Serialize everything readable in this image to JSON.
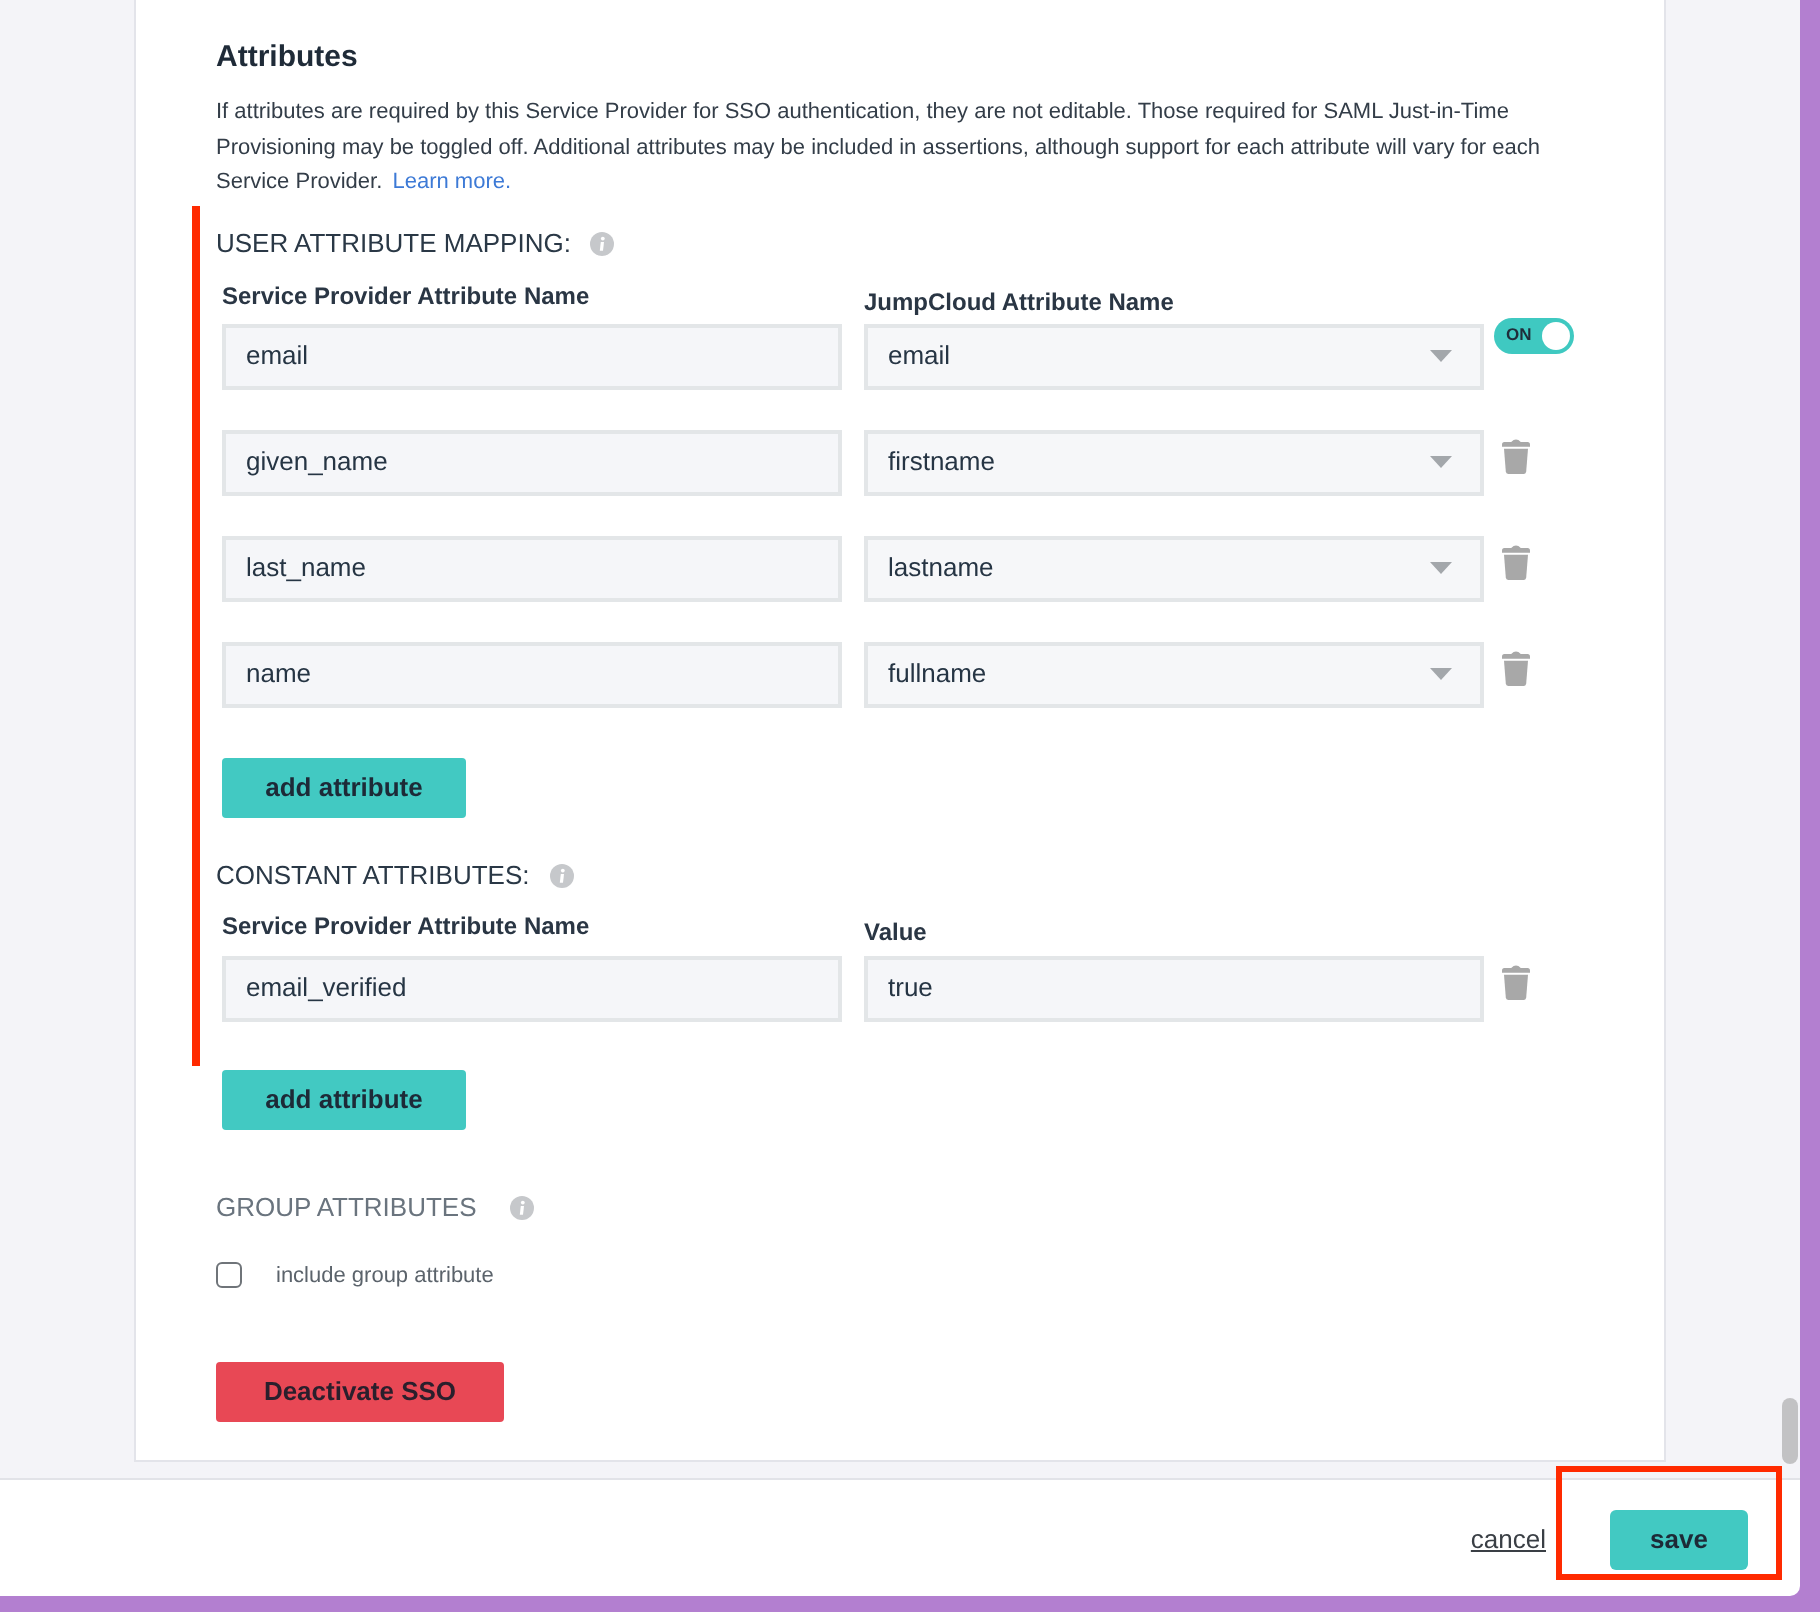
{
  "section": {
    "title": "Attributes",
    "description": "If attributes are required by this Service Provider for SSO authentication, they are not editable. Those required for SAML Just-in-Time Provisioning may be toggled off. Additional attributes may be included in assertions, although support for each attribute will vary for each Service Provider.",
    "link": "Learn more."
  },
  "user_attribute_mapping": {
    "heading": "USER ATTRIBUTE MAPPING:",
    "columns": [
      "Service Provider Attribute Name",
      "JumpCloud Attribute Name"
    ],
    "rows": [
      {
        "kind": "dropdown",
        "name": "email",
        "value": "email",
        "action": {
          "kind": "toggle",
          "on": true,
          "label": "ON"
        }
      },
      {
        "kind": "dropdown",
        "name": "given_name",
        "value": "firstname",
        "action": {
          "kind": "delete"
        }
      },
      {
        "kind": "dropdown",
        "name": "last_name",
        "value": "lastname",
        "action": {
          "kind": "delete"
        }
      },
      {
        "kind": "dropdown",
        "name": "name",
        "value": "fullname",
        "action": {
          "kind": "delete"
        }
      }
    ],
    "add_button": "add attribute"
  },
  "constant_attributes": {
    "heading": "CONSTANT ATTRIBUTES:",
    "columns": [
      "Service Provider Attribute Name",
      "Value"
    ],
    "rows": [
      {
        "kind": "text",
        "name": "email_verified",
        "value": "true",
        "action": {
          "kind": "delete"
        }
      }
    ],
    "add_button": "add attribute"
  },
  "group_attributes": {
    "heading": "GROUP ATTRIBUTES",
    "checkbox": {
      "label": "include group attribute",
      "checked": false
    }
  },
  "deactivate_button": "Deactivate SSO",
  "footer": {
    "cancel": "cancel",
    "save": "save"
  }
}
